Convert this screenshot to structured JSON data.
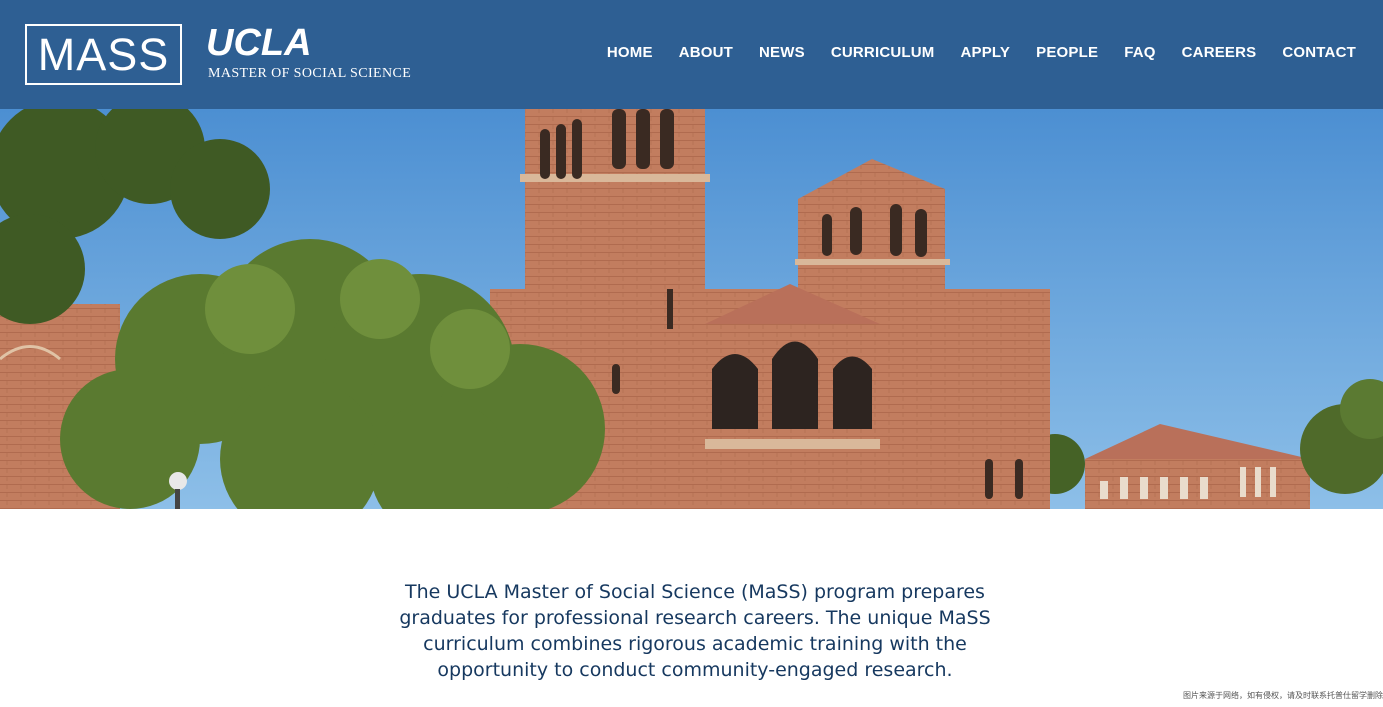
{
  "logo": {
    "mass": "MASS",
    "ucla": "UCLA",
    "subtitle": "Master of Social Science"
  },
  "nav": {
    "items": [
      {
        "label": "HOME"
      },
      {
        "label": "ABOUT"
      },
      {
        "label": "NEWS"
      },
      {
        "label": "CURRICULUM"
      },
      {
        "label": "APPLY"
      },
      {
        "label": "PEOPLE"
      },
      {
        "label": "FAQ"
      },
      {
        "label": "CAREERS"
      },
      {
        "label": "CONTACT"
      }
    ]
  },
  "intro": {
    "text": "The UCLA Master of Social Science (MaSS) program prepares graduates for professional research careers. The unique MaSS curriculum combines rigorous academic training with the opportunity to conduct community-engaged research."
  },
  "watermark": "图片来源于网络，如有侵权，请及时联系托普仕留学删除",
  "colors": {
    "header": "#2e5f93",
    "intro_text": "#16385f",
    "brick": "#c07a5c",
    "sky": "#6aa7dd"
  }
}
